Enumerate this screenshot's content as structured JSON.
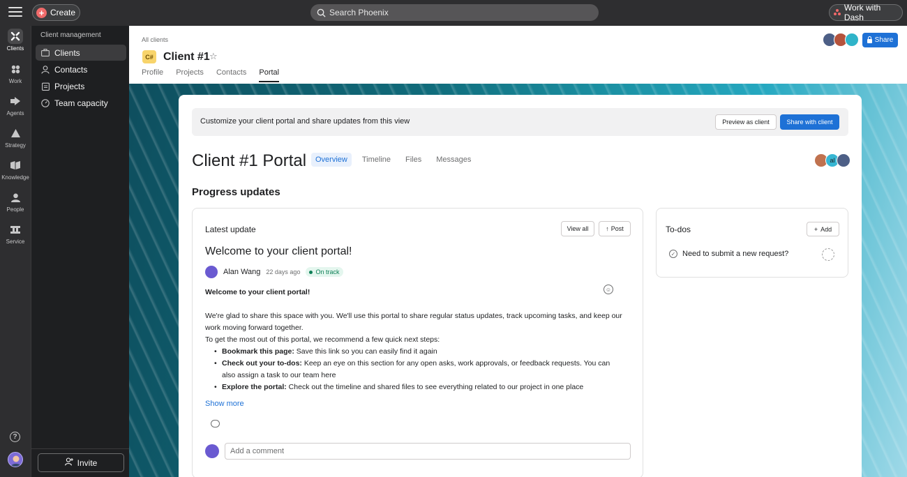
{
  "topbar": {
    "create_label": "Create",
    "search_placeholder": "Search Phoenix",
    "workspace_label": "Work with Dash"
  },
  "rail": {
    "items": [
      {
        "label": "Clients",
        "icon": "clients-icon"
      },
      {
        "label": "Work",
        "icon": "work-icon"
      },
      {
        "label": "Agents",
        "icon": "agents-icon"
      },
      {
        "label": "Strategy",
        "icon": "strategy-icon"
      },
      {
        "label": "Knowledge",
        "icon": "knowledge-icon"
      },
      {
        "label": "People",
        "icon": "people-icon"
      },
      {
        "label": "Service",
        "icon": "service-icon"
      }
    ],
    "help_glyph": "?"
  },
  "subsidebar": {
    "section_title": "Client management",
    "items": [
      {
        "label": "Clients"
      },
      {
        "label": "Contacts"
      },
      {
        "label": "Projects"
      },
      {
        "label": "Team capacity"
      }
    ],
    "invite_label": "Invite"
  },
  "header": {
    "breadcrumb": "All clients",
    "badge": "C#",
    "title": "Client #1",
    "tabs": [
      "Profile",
      "Projects",
      "Contacts",
      "Portal"
    ],
    "active_tab": "Portal",
    "share_label": "Share"
  },
  "portal": {
    "banner_text": "Customize your client portal and share updates from this view",
    "preview_label": "Preview as client",
    "share_client_label": "Share with client",
    "title": "Client #1 Portal",
    "tabs": [
      "Overview",
      "Timeline",
      "Files",
      "Messages"
    ],
    "avatar_initials": "al",
    "section_title": "Progress updates"
  },
  "update": {
    "label": "Latest update",
    "view_all": "View all",
    "post": "Post",
    "title": "Welcome to your client portal!",
    "author": "Alan Wang",
    "time": "22 days ago",
    "status": "On track",
    "heading": "Welcome to your client portal!",
    "para1": "We're glad to share this space with you. We'll use this portal to share regular status updates, track upcoming tasks, and keep our work moving forward together.",
    "para2": "To get the most out of this portal, we recommend a few quick next steps:",
    "bullets": [
      {
        "bold": "Bookmark this page:",
        "text": " Save this link so you can easily find it again"
      },
      {
        "bold": "Check out your to-dos:",
        "text": " Keep an eye on this section for any open asks, work approvals, or feedback requests. You can also assign a task to our team here"
      },
      {
        "bold": "Explore the portal:",
        "text": " Check out the timeline and shared files to see everything related to our project in one place"
      }
    ],
    "show_more": "Show more",
    "comment_placeholder": "Add a comment"
  },
  "todos": {
    "title": "To-dos",
    "add_label": "Add",
    "items": [
      {
        "label": "Need to submit a new request?"
      }
    ]
  },
  "colors": {
    "accent_blue": "#1e71d6",
    "status_green": "#0d7f56",
    "create_red": "#f06a6a",
    "badge_yellow": "#f8d46b"
  }
}
